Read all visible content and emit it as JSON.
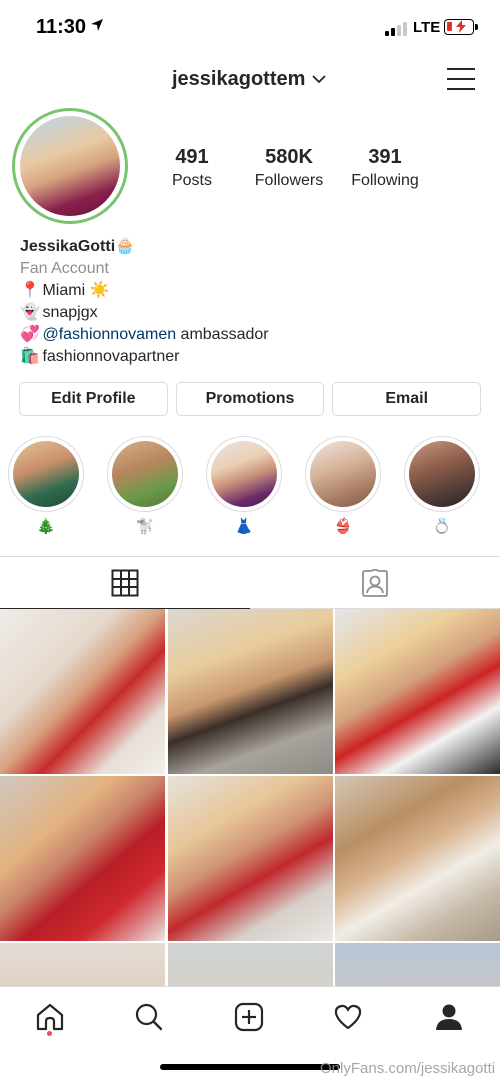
{
  "status_bar": {
    "time": "11:30",
    "network": "LTE"
  },
  "header": {
    "username": "jessikagottem"
  },
  "stats": [
    {
      "value": "491",
      "label": "Posts"
    },
    {
      "value": "580K",
      "label": "Followers"
    },
    {
      "value": "391",
      "label": "Following"
    }
  ],
  "bio": {
    "name": "JessikaGotti",
    "name_emoji": "🧁",
    "category": "Fan Account",
    "lines": [
      {
        "emoji": "📍",
        "text": "Miami",
        "suffix_emoji": "☀️"
      },
      {
        "emoji": "👻",
        "text": "snapjgx"
      },
      {
        "emoji": "💞",
        "link": "@fashionnovamen",
        "text": " ambassador"
      },
      {
        "emoji": "🛍️",
        "text": "fashionnovapartner"
      }
    ]
  },
  "actions": {
    "edit_profile": "Edit Profile",
    "promotions": "Promotions",
    "email": "Email"
  },
  "highlights": [
    {
      "label": "🎄",
      "color_a": "#2f6b4f",
      "color_b": "#e3c39a"
    },
    {
      "label": "🐩",
      "color_a": "#6c9a4a",
      "color_b": "#d9b08a"
    },
    {
      "label": "👗",
      "color_a": "#6a2a6a",
      "color_b": "#ead0b4"
    },
    {
      "label": "👙",
      "color_a": "#d7b49a",
      "color_b": "#a77a63"
    },
    {
      "label": "💍",
      "color_a": "#4d3a36",
      "color_b": "#c89b82"
    }
  ],
  "colors": {
    "accent_link": "#00376b",
    "avatar_ring": "#7ac470",
    "notification_dot": "#ed4956"
  },
  "watermark": "OnlyFans.com/jessikagotti"
}
